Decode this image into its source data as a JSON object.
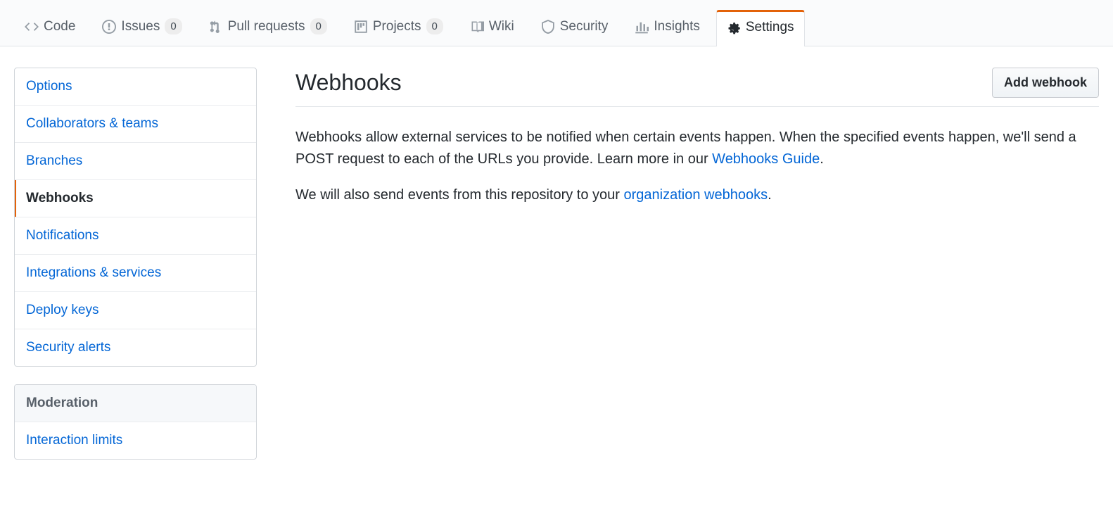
{
  "tabs": {
    "code": {
      "label": "Code"
    },
    "issues": {
      "label": "Issues",
      "count": "0"
    },
    "pulls": {
      "label": "Pull requests",
      "count": "0"
    },
    "projects": {
      "label": "Projects",
      "count": "0"
    },
    "wiki": {
      "label": "Wiki"
    },
    "security": {
      "label": "Security"
    },
    "insights": {
      "label": "Insights"
    },
    "settings": {
      "label": "Settings"
    }
  },
  "sidebar": {
    "items": [
      {
        "label": "Options"
      },
      {
        "label": "Collaborators & teams"
      },
      {
        "label": "Branches"
      },
      {
        "label": "Webhooks"
      },
      {
        "label": "Notifications"
      },
      {
        "label": "Integrations & services"
      },
      {
        "label": "Deploy keys"
      },
      {
        "label": "Security alerts"
      }
    ],
    "moderation_header": "Moderation",
    "moderation_items": [
      {
        "label": "Interaction limits"
      }
    ]
  },
  "page": {
    "title": "Webhooks",
    "add_button": "Add webhook",
    "p1_a": "Webhooks allow external services to be notified when certain events happen. When the specified events happen, we'll send a POST request to each of the URLs you provide. Learn more in our ",
    "p1_link": "Webhooks Guide",
    "p1_b": ".",
    "p2_a": "We will also send events from this repository to your ",
    "p2_link": "organization webhooks",
    "p2_b": "."
  }
}
